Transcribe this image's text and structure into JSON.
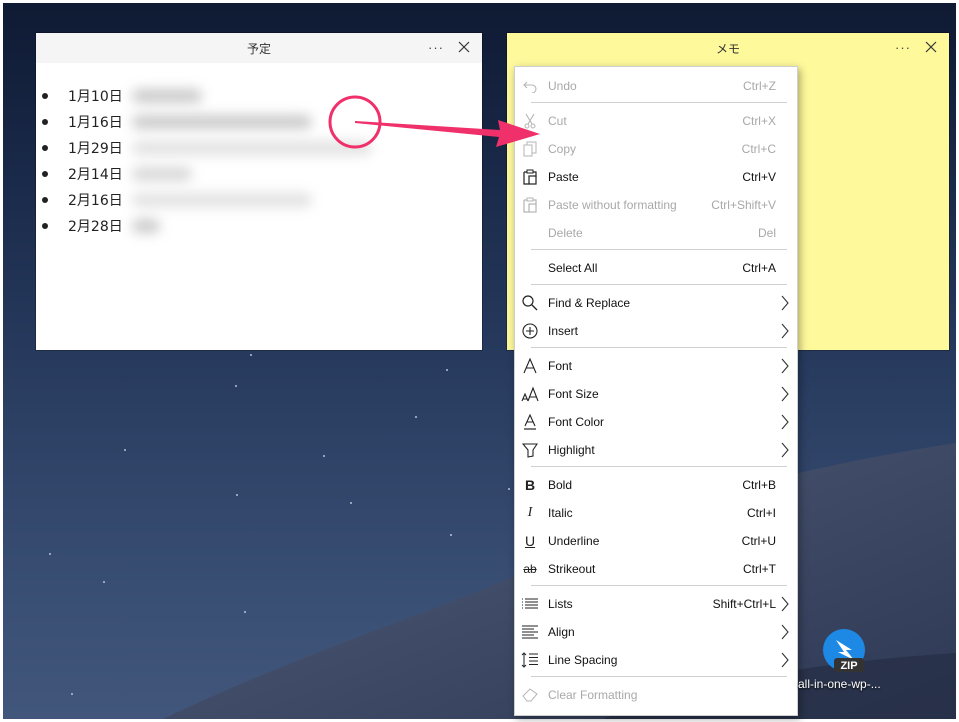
{
  "desktop": {
    "zip_file_label": "all-in-one-wp-...",
    "zip_badge": "ZIP"
  },
  "note_schedule": {
    "title": "予定",
    "more_icon": "ellipsis-icon",
    "close_icon": "close-icon",
    "items": [
      {
        "date": "1月10日"
      },
      {
        "date": "1月16日"
      },
      {
        "date": "1月29日"
      },
      {
        "date": "2月14日"
      },
      {
        "date": "2月16日"
      },
      {
        "date": "2月28日"
      }
    ]
  },
  "note_memo": {
    "title": "メモ",
    "background": "#fef99b"
  },
  "annotation": {
    "color": "#f0306a"
  },
  "context_menu": {
    "items": [
      {
        "label": "Undo",
        "shortcut": "Ctrl+Z",
        "icon": "undo-icon",
        "enabled": false
      },
      {
        "label": "Cut",
        "shortcut": "Ctrl+X",
        "icon": "scissors-icon",
        "enabled": false
      },
      {
        "label": "Copy",
        "shortcut": "Ctrl+C",
        "icon": "copy-icon",
        "enabled": false
      },
      {
        "label": "Paste",
        "shortcut": "Ctrl+V",
        "icon": "clipboard-icon",
        "enabled": true
      },
      {
        "label": "Paste without formatting",
        "shortcut": "Ctrl+Shift+V",
        "icon": "clipboard-icon",
        "enabled": false
      },
      {
        "label": "Delete",
        "shortcut": "Del",
        "icon": "",
        "enabled": false
      },
      {
        "label": "Select All",
        "shortcut": "Ctrl+A",
        "icon": "",
        "enabled": true
      },
      {
        "label": "Find & Replace",
        "shortcut": "",
        "icon": "search-icon",
        "enabled": true,
        "submenu": true
      },
      {
        "label": "Insert",
        "shortcut": "",
        "icon": "plus-circle-icon",
        "enabled": true,
        "submenu": true
      },
      {
        "label": "Font",
        "shortcut": "",
        "icon": "font-icon",
        "enabled": true,
        "submenu": true
      },
      {
        "label": "Font Size",
        "shortcut": "",
        "icon": "font-size-icon",
        "enabled": true,
        "submenu": true
      },
      {
        "label": "Font Color",
        "shortcut": "",
        "icon": "font-color-icon",
        "enabled": true,
        "submenu": true
      },
      {
        "label": "Highlight",
        "shortcut": "",
        "icon": "highlighter-icon",
        "enabled": true,
        "submenu": true
      },
      {
        "label": "Bold",
        "shortcut": "Ctrl+B",
        "icon": "bold-icon",
        "enabled": true
      },
      {
        "label": "Italic",
        "shortcut": "Ctrl+I",
        "icon": "italic-icon",
        "enabled": true
      },
      {
        "label": "Underline",
        "shortcut": "Ctrl+U",
        "icon": "underline-icon",
        "enabled": true
      },
      {
        "label": "Strikeout",
        "shortcut": "Ctrl+T",
        "icon": "strikethrough-icon",
        "enabled": true
      },
      {
        "label": "Lists",
        "shortcut": "Shift+Ctrl+L",
        "icon": "list-icon",
        "enabled": true,
        "submenu": true
      },
      {
        "label": "Align",
        "shortcut": "",
        "icon": "align-icon",
        "enabled": true,
        "submenu": true
      },
      {
        "label": "Line Spacing",
        "shortcut": "",
        "icon": "line-spacing-icon",
        "enabled": true,
        "submenu": true
      },
      {
        "label": "Clear Formatting",
        "shortcut": "",
        "icon": "eraser-icon",
        "enabled": false
      }
    ]
  }
}
